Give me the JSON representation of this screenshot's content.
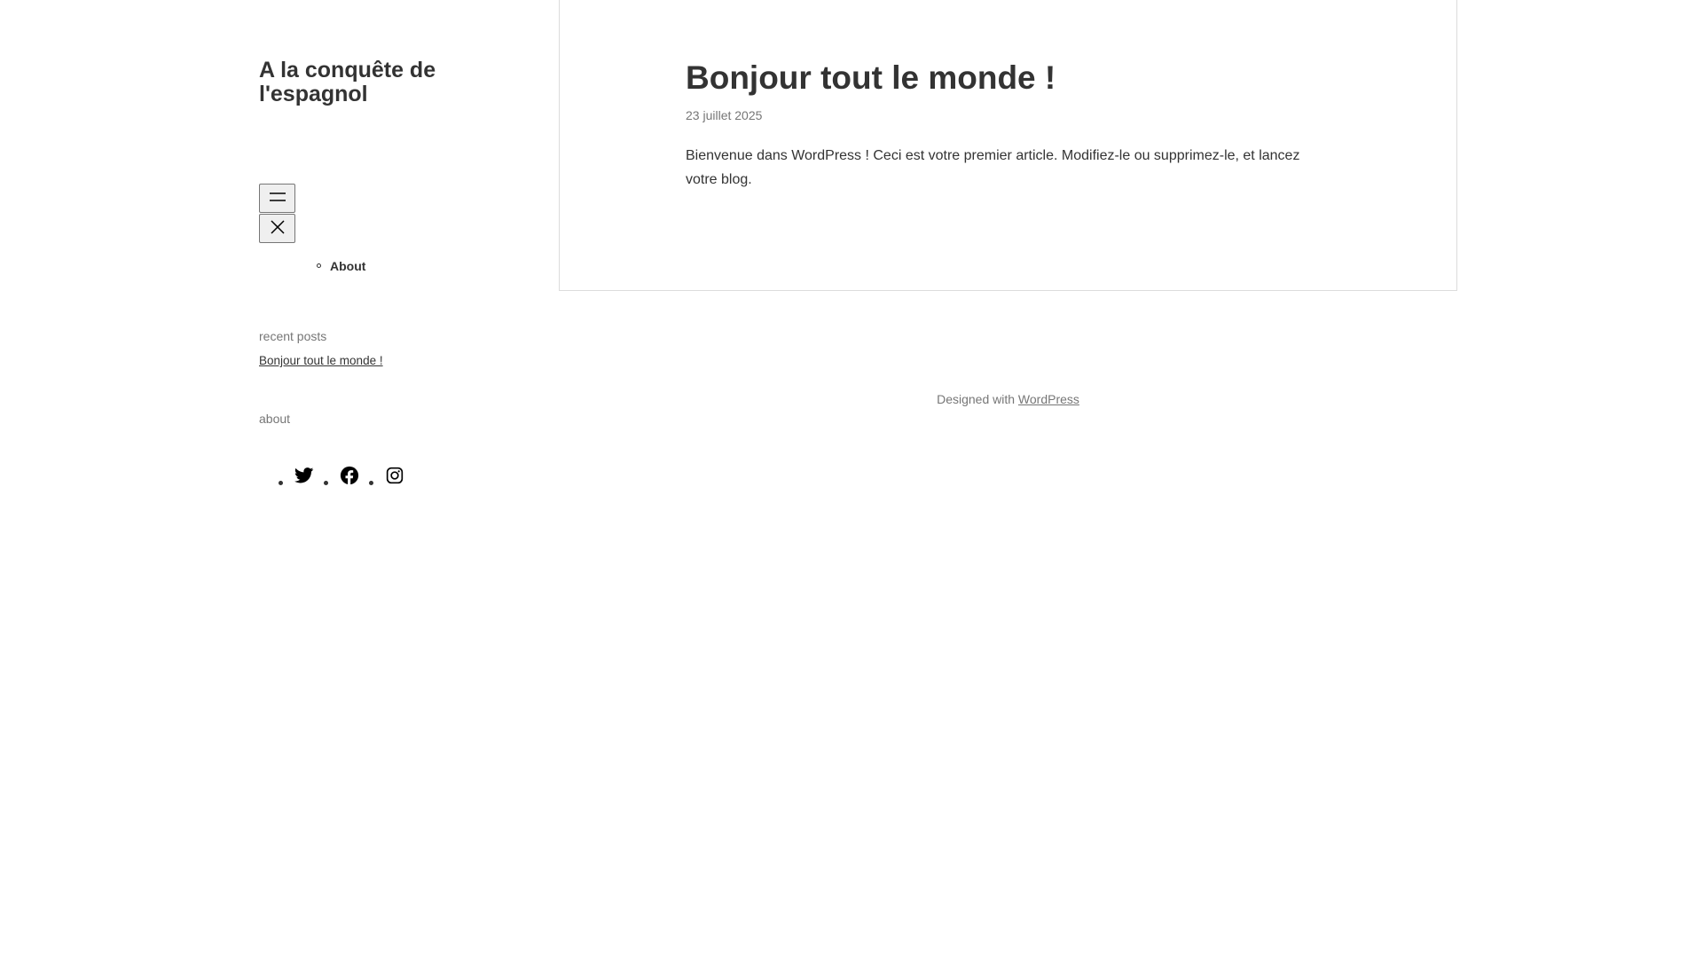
{
  "site": {
    "title": "A la conquête de l'espagnol"
  },
  "nav": {
    "open_icon": "menu-icon",
    "close_icon": "close-icon",
    "items": [
      {
        "label": "About"
      }
    ]
  },
  "widgets": {
    "recent_posts_heading": "recent posts",
    "recent_posts": [
      {
        "title": "Bonjour tout le monde !"
      }
    ],
    "about_heading": "about",
    "social_icons": [
      "twitter-icon",
      "facebook-icon",
      "instagram-icon"
    ]
  },
  "post": {
    "title": "Bonjour tout le monde !",
    "date": "23 juillet 2025",
    "content": "Bienvenue dans WordPress ! Ceci est votre premier article. Modifiez-le ou supprimez-le, et lancez votre blog."
  },
  "footer": {
    "prefix": "Designed with ",
    "link_text": "WordPress"
  },
  "colors": {
    "text": "#333333",
    "muted": "#767676",
    "border": "#dcdcdc",
    "button_bg": "#efefef"
  }
}
